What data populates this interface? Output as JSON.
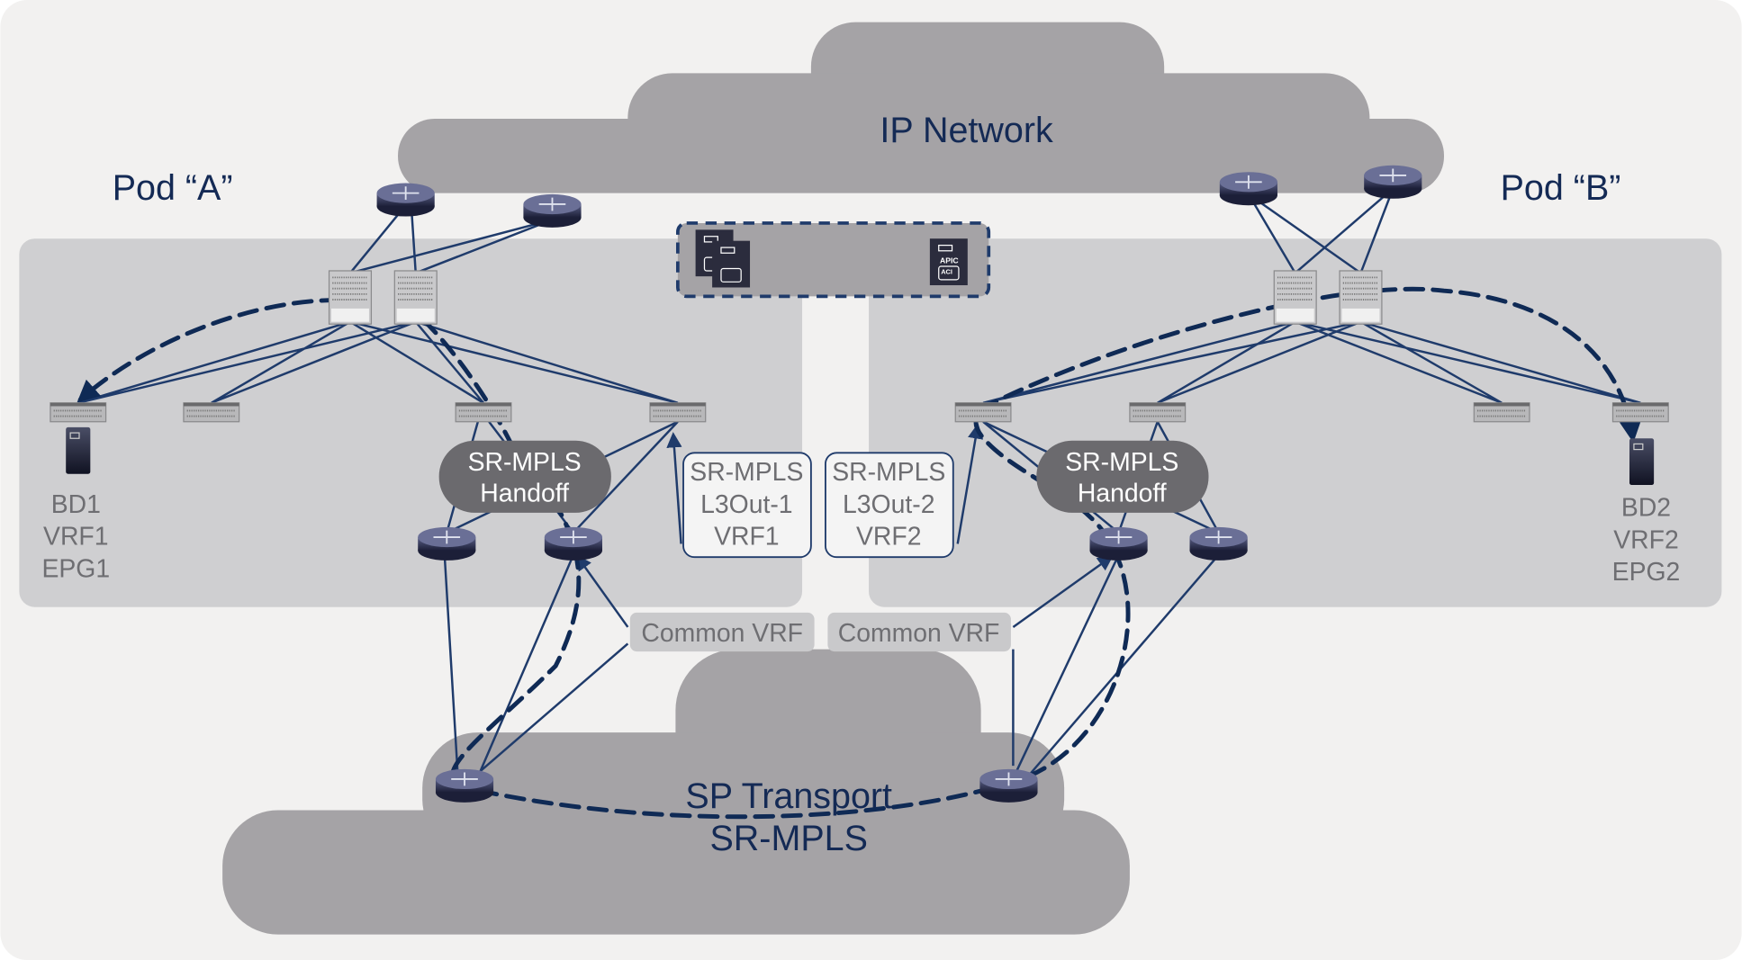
{
  "title_ip_network": "IP Network",
  "pod_a": {
    "label": "Pod “A”",
    "endpoint": [
      "BD1",
      "VRF1",
      "EPG1"
    ],
    "handoff": [
      "SR-MPLS",
      "Handoff"
    ],
    "l3out": [
      "SR-MPLS",
      "L3Out-1",
      "VRF1"
    ],
    "common_vrf": "Common VRF"
  },
  "pod_b": {
    "label": "Pod “B”",
    "endpoint": [
      "BD2",
      "VRF2",
      "EPG2"
    ],
    "handoff": [
      "SR-MPLS",
      "Handoff"
    ],
    "l3out": [
      "SR-MPLS",
      "L3Out-2",
      "VRF2"
    ],
    "common_vrf": "Common VRF"
  },
  "sp_transport": [
    "SP Transport",
    "SR-MPLS"
  ],
  "apic": {
    "label": "APIC",
    "badge": "ACI"
  },
  "colors": {
    "link": "#1f3b6b",
    "cloud": "#a5a3a6",
    "pod": "#cfcfd1",
    "handoff": "#6b6a6e"
  }
}
